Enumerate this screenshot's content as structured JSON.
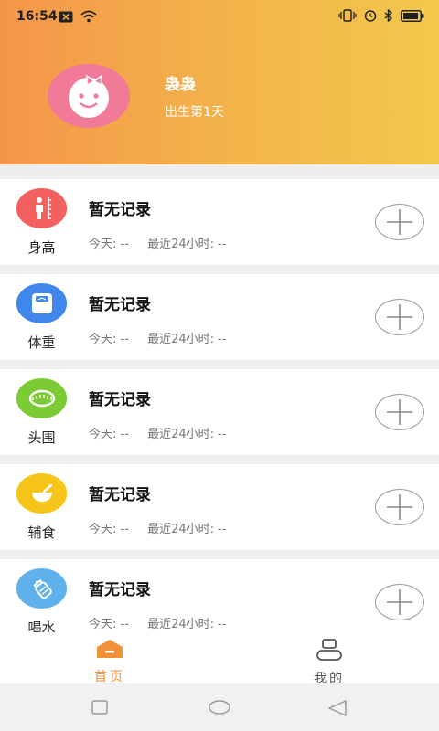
{
  "status_bar": {
    "time": "16:54",
    "left_icons": [
      "close-box-icon",
      "wifi-icon"
    ],
    "right_icons": [
      "vibrate-icon",
      "alarm-icon",
      "bluetooth-icon",
      "battery-icon"
    ]
  },
  "profile": {
    "name": "袅袅",
    "age_text": "出生第1天"
  },
  "records": [
    {
      "key": "height",
      "label": "身高",
      "icon": "height-measure-icon",
      "color": "#f26060",
      "title": "暂无记录",
      "today_label": "今天:",
      "today_value": "--",
      "recent_label": "最近24小时:",
      "recent_value": "--"
    },
    {
      "key": "weight",
      "label": "体重",
      "icon": "scale-icon",
      "color": "#3f87ea",
      "title": "暂无记录",
      "today_label": "今天:",
      "today_value": "--",
      "recent_label": "最近24小时:",
      "recent_value": "--"
    },
    {
      "key": "head",
      "label": "头围",
      "icon": "tape-measure-icon",
      "color": "#7ccb35",
      "title": "暂无记录",
      "today_label": "今天:",
      "today_value": "--",
      "recent_label": "最近24小时:",
      "recent_value": "--"
    },
    {
      "key": "food",
      "label": "辅食",
      "icon": "bowl-icon",
      "color": "#f7c41a",
      "title": "暂无记录",
      "today_label": "今天:",
      "today_value": "--",
      "recent_label": "最近24小时:",
      "recent_value": "--"
    },
    {
      "key": "water",
      "label": "喝水",
      "icon": "baby-bottle-icon",
      "color": "#5fb1ec",
      "title": "暂无记录",
      "today_label": "今天:",
      "today_value": "--",
      "recent_label": "最近24小时:",
      "recent_value": "--"
    }
  ],
  "bottom_nav": {
    "home_label": "首页",
    "mine_label": "我的",
    "active_color": "#f0923a",
    "inactive_color": "#555555"
  },
  "system_nav": [
    "square-icon",
    "circle-icon",
    "back-triangle-icon"
  ]
}
